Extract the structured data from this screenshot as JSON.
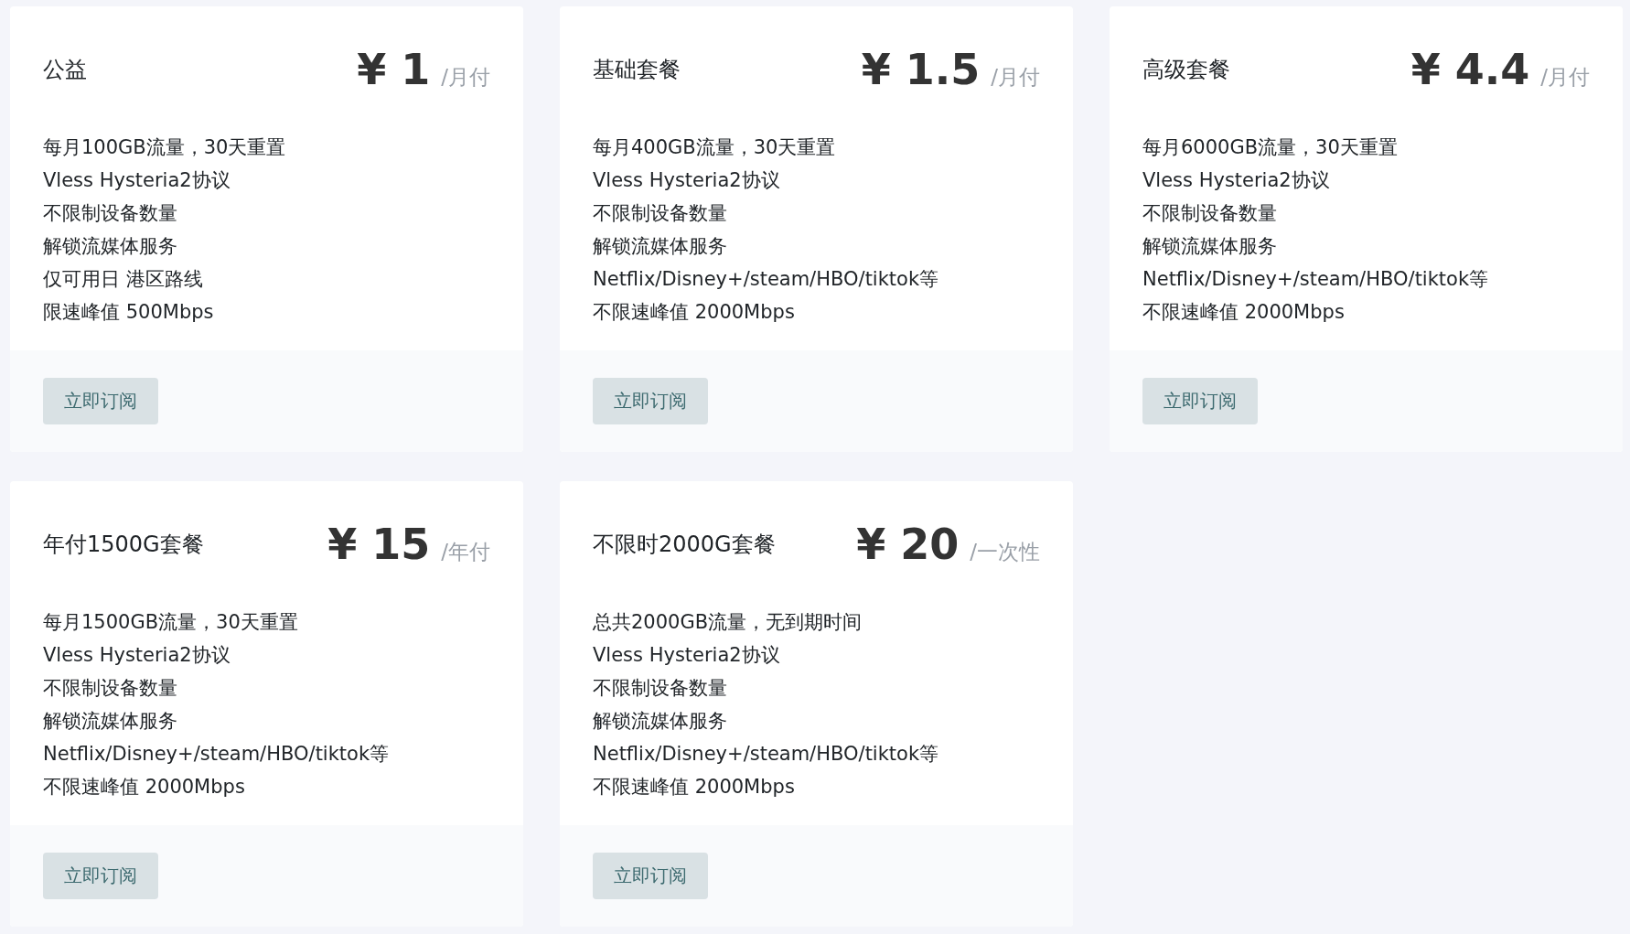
{
  "plans": [
    {
      "name": "公益",
      "price": "¥ 1",
      "period": "/月付",
      "features": [
        "每月100GB流量，30天重置",
        "Vless Hysteria2协议",
        "不限制设备数量",
        "解锁流媒体服务",
        "仅可用日 港区路线",
        "限速峰值 500Mbps"
      ],
      "button": "立即订阅"
    },
    {
      "name": "基础套餐",
      "price": "¥ 1.5",
      "period": "/月付",
      "features": [
        "每月400GB流量，30天重置",
        "Vless Hysteria2协议",
        "不限制设备数量",
        "解锁流媒体服务",
        "Netflix/Disney+/steam/HBO/tiktok等",
        "不限速峰值 2000Mbps"
      ],
      "button": "立即订阅"
    },
    {
      "name": "高级套餐",
      "price": "¥ 4.4",
      "period": "/月付",
      "features": [
        "每月6000GB流量，30天重置",
        "Vless Hysteria2协议",
        "不限制设备数量",
        "解锁流媒体服务",
        "Netflix/Disney+/steam/HBO/tiktok等",
        "不限速峰值 2000Mbps"
      ],
      "button": "立即订阅"
    },
    {
      "name": "年付1500G套餐",
      "price": "¥ 15",
      "period": "/年付",
      "features": [
        "每月1500GB流量，30天重置",
        "Vless Hysteria2协议",
        "不限制设备数量",
        "解锁流媒体服务",
        "Netflix/Disney+/steam/HBO/tiktok等",
        "不限速峰值 2000Mbps"
      ],
      "button": "立即订阅"
    },
    {
      "name": "不限时2000G套餐",
      "price": "¥ 20",
      "period": "/一次性",
      "features": [
        "总共2000GB流量，无到期时间",
        "Vless Hysteria2协议",
        "不限制设备数量",
        "解锁流媒体服务",
        "Netflix/Disney+/steam/HBO/tiktok等",
        "不限速峰值 2000Mbps"
      ],
      "button": "立即订阅"
    }
  ]
}
